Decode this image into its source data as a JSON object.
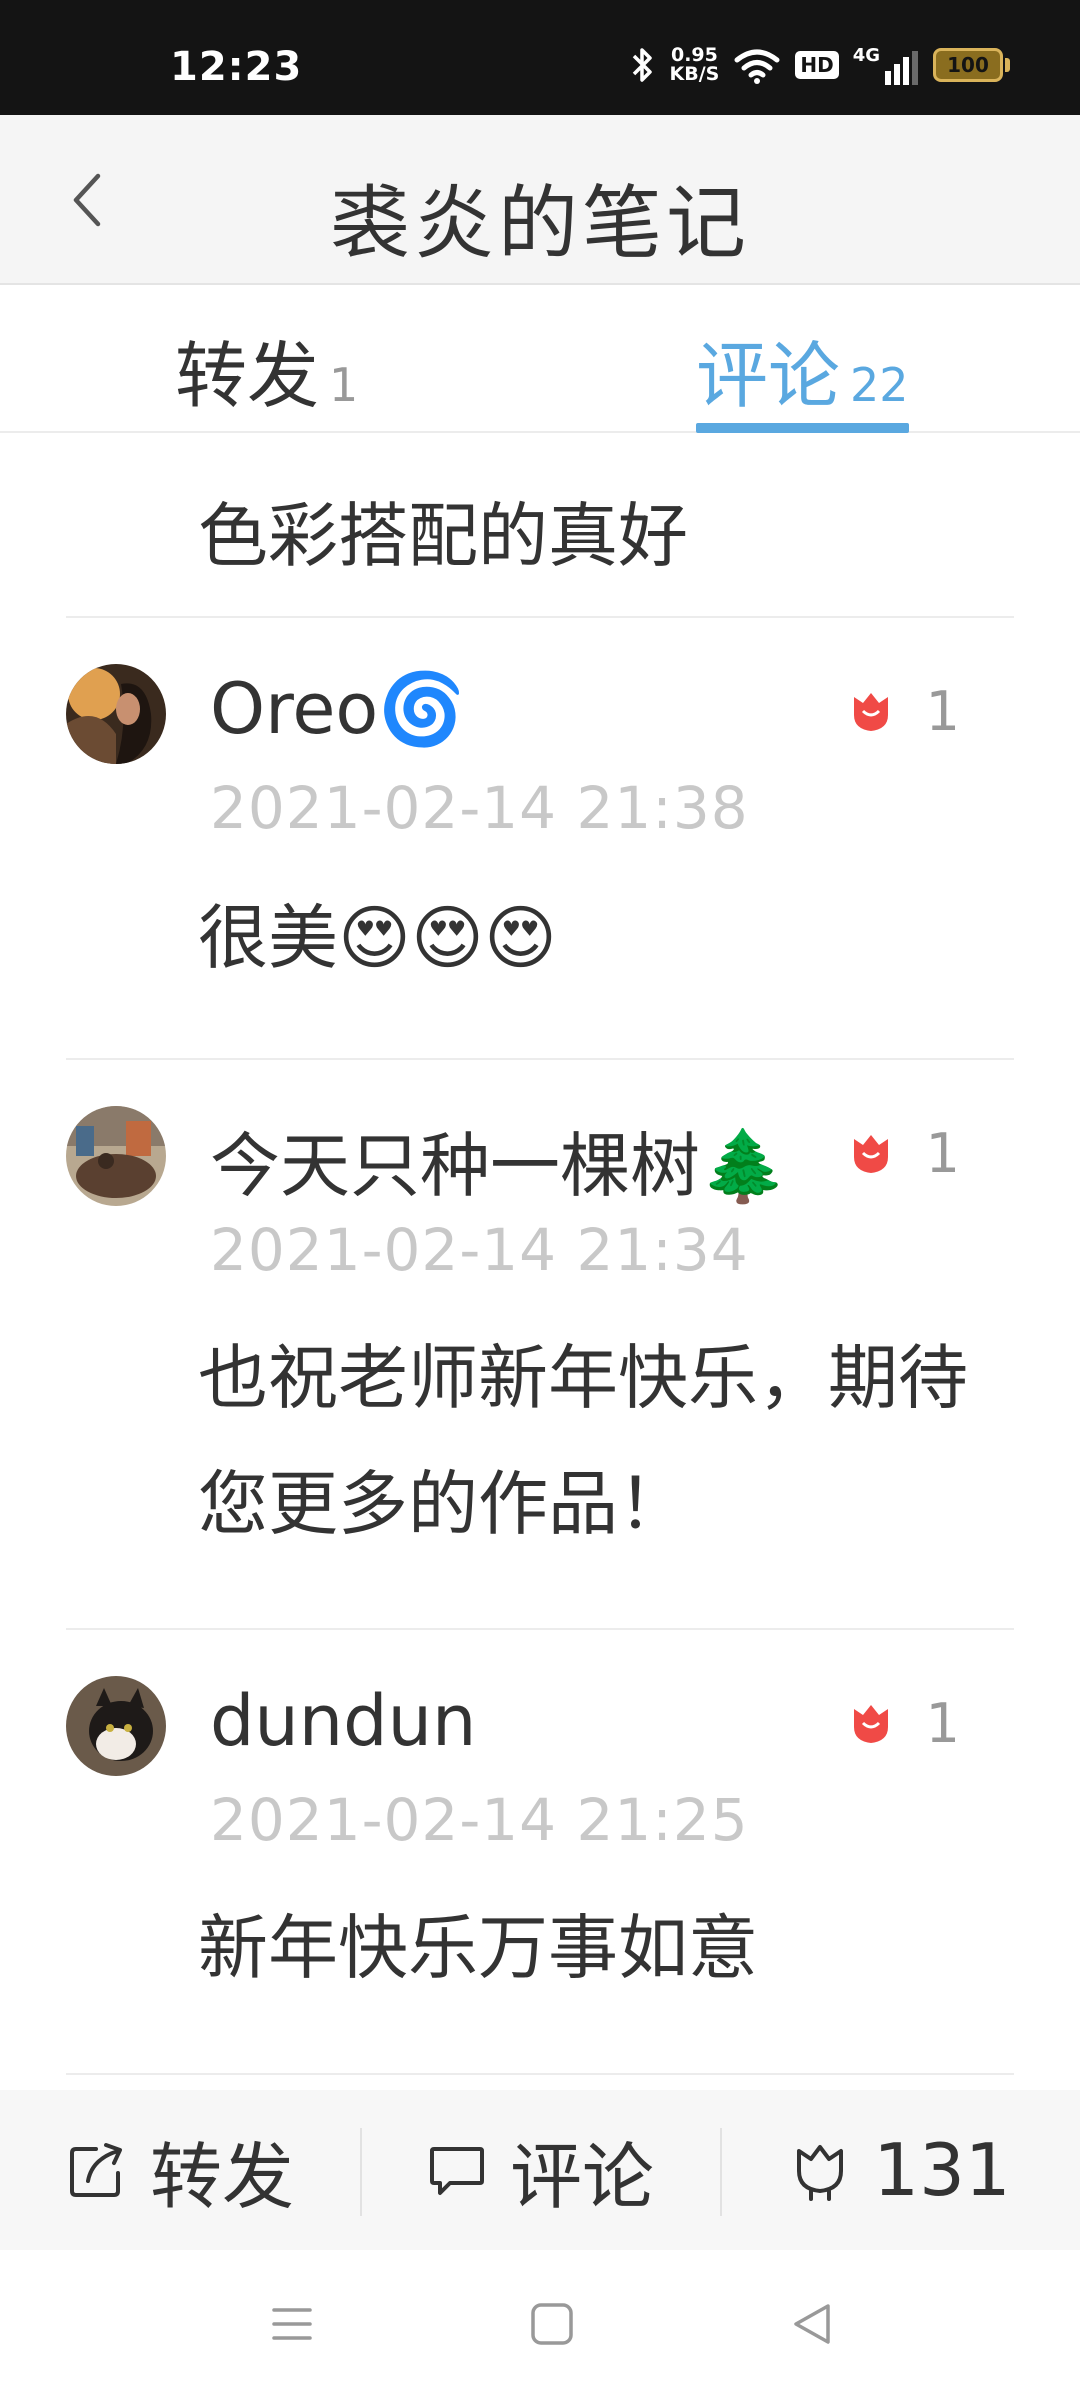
{
  "status_bar": {
    "time": "12:23",
    "net_speed_value": "0.95",
    "net_speed_unit": "KB/S",
    "hd_label": "HD",
    "network_label": "4G",
    "battery_level": "100",
    "icons": [
      "bluetooth-icon",
      "wifi-icon",
      "signal-icon",
      "battery-icon"
    ]
  },
  "header": {
    "title": "裘炎的笔记",
    "back_icon": "chevron-left-icon"
  },
  "tabs": [
    {
      "label": "转发",
      "count": "1",
      "active": false
    },
    {
      "label": "评论",
      "count": "22",
      "active": true
    }
  ],
  "colors": {
    "accent": "#5aa8e0",
    "like": "#f04a46",
    "timestamp": "#c8c8c8",
    "text": "#333333"
  },
  "comments": {
    "partial": {
      "text": "色彩搭配的真好"
    },
    "items": [
      {
        "user": "Oreo🌀",
        "time": "2021-02-14 21:38",
        "text": "很美😍😍😍",
        "likes": "1"
      },
      {
        "user": "今天只种一棵树🌲",
        "time": "2021-02-14 21:34",
        "text": "也祝老师新年快乐，期待您更多的作品！",
        "likes": "1"
      },
      {
        "user": "dundun",
        "time": "2021-02-14 21:25",
        "text": "新年快乐万事如意",
        "likes": "1"
      }
    ]
  },
  "action_bar": {
    "forward_label": "转发",
    "comment_label": "评论",
    "like_count": "131"
  },
  "nav_bar": {
    "icons": [
      "menu-icon",
      "home-icon",
      "back-triangle-icon"
    ]
  }
}
